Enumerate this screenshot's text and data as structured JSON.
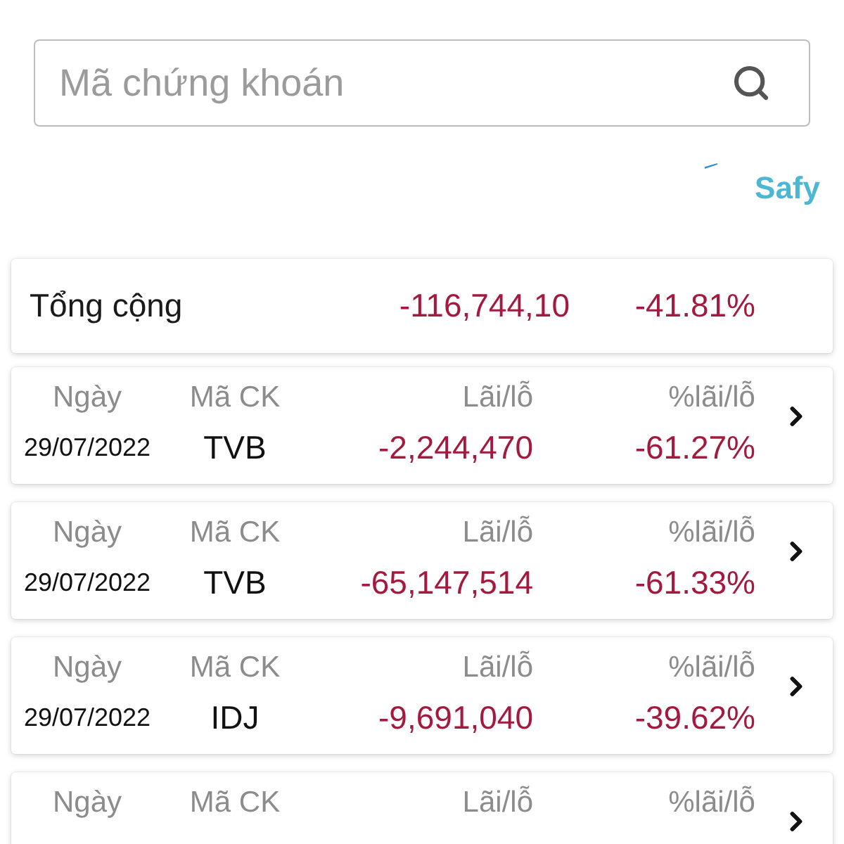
{
  "search": {
    "placeholder": "Mã chứng khoán"
  },
  "brand": {
    "name": "Safy"
  },
  "total": {
    "label": "Tổng cộng",
    "profit_loss": "-116,744,10",
    "percent": "-41.81%"
  },
  "rows": [
    {
      "labels": [
        "Ngày",
        "Mã CK",
        "Lãi/lỗ",
        "%lãi/lỗ"
      ],
      "date": "29/07/2022",
      "symbol": "TVB",
      "profit_loss": "-2,244,470",
      "percent": "-61.27%"
    },
    {
      "labels": [
        "Ngày",
        "Mã CK",
        "Lãi/lỗ",
        "%lãi/lỗ"
      ],
      "date": "29/07/2022",
      "symbol": "TVB",
      "profit_loss": "-65,147,514",
      "percent": "-61.33%"
    },
    {
      "labels": [
        "Ngày",
        "Mã CK",
        "Lãi/lỗ",
        "%lãi/lỗ"
      ],
      "date": "29/07/2022",
      "symbol": "IDJ",
      "profit_loss": "-9,691,040",
      "percent": "-39.62%"
    },
    {
      "labels": [
        "Ngày",
        "Mã CK",
        "Lãi/lỗ",
        "%lãi/lỗ"
      ]
    }
  ]
}
